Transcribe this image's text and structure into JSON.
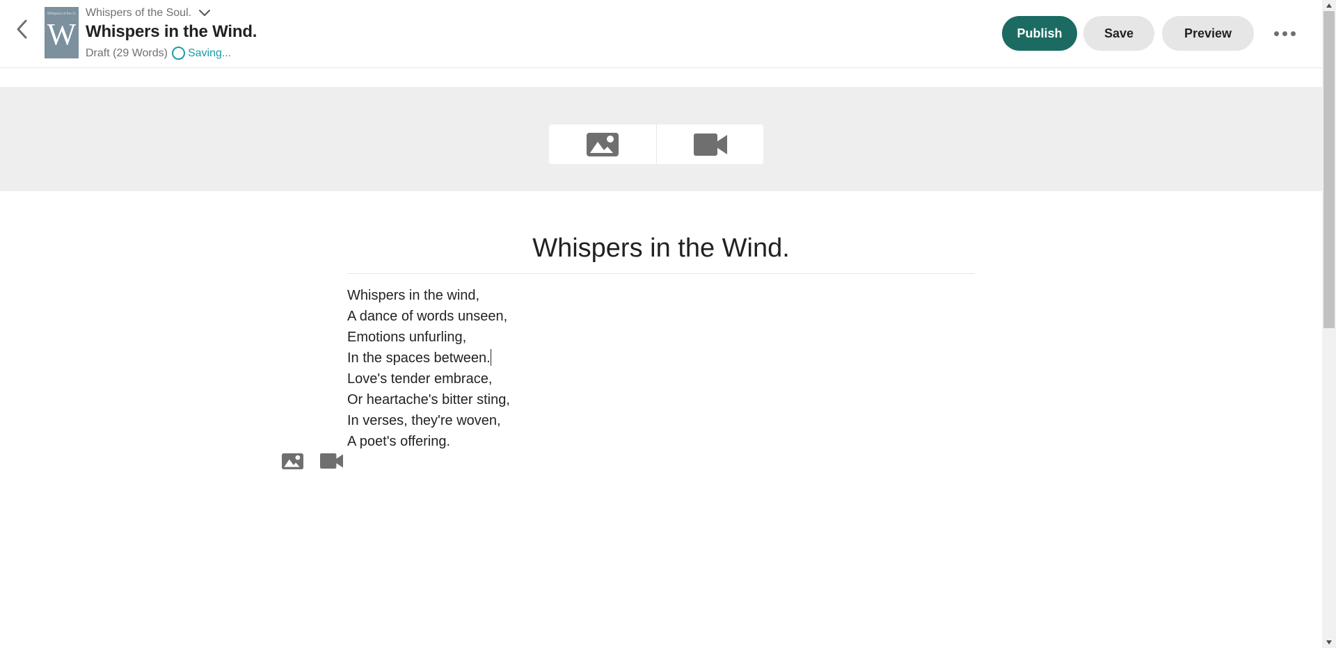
{
  "header": {
    "story_name": "Whispers of the Soul.",
    "part_title": "Whispers in the Wind.",
    "draft_status": "Draft (29 Words)",
    "saving_status": "Saving...",
    "cover": {
      "letter": "W",
      "small_text": "Whispers of the Soul"
    },
    "actions": {
      "publish": "Publish",
      "save": "Save",
      "preview": "Preview"
    },
    "colors": {
      "publish_bg": "#1b6b62",
      "secondary_bg": "#e6e6e6",
      "saving": "#1a9ba8"
    }
  },
  "media_banner": {
    "buttons": [
      {
        "icon": "image-icon"
      },
      {
        "icon": "video-camera-icon"
      }
    ]
  },
  "editor": {
    "title": "Whispers in the Wind.",
    "lines": [
      "Whispers in the wind,",
      "A dance of words unseen,",
      "Emotions unfurling,",
      "In the spaces between.",
      "Love's tender embrace,",
      "Or heartache's bitter sting,",
      "In verses, they're woven,",
      "A poet's offering."
    ],
    "inline_media": [
      {
        "icon": "image-icon"
      },
      {
        "icon": "video-camera-icon"
      }
    ]
  }
}
